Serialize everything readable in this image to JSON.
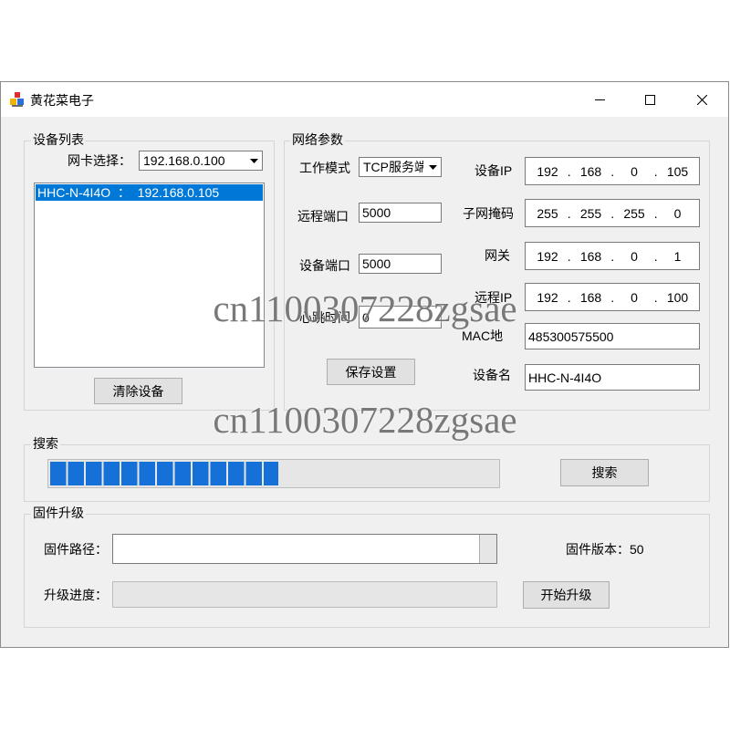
{
  "window": {
    "title": "黄花菜电子"
  },
  "icons": {
    "app": "app-icon",
    "minimize": "minimize-icon",
    "maximize": "maximize-icon",
    "close": "close-icon",
    "dropdown": "chevron-down-icon"
  },
  "theme": {
    "selection_color": "#0078d7",
    "progress_color": "#1570d8",
    "window_background": "#f0f0f0"
  },
  "device_list": {
    "group_label": "设备列表",
    "nic_label": "网卡选择：",
    "nic_selected": "192.168.0.100",
    "items": [
      {
        "text": "HHC-N-4I4O  ：  192.168.0.105",
        "selected": true
      }
    ],
    "clear_button": "清除设备"
  },
  "network_params": {
    "group_label": "网络参数",
    "ip_separator": ".",
    "work_mode": {
      "label": "工作模式",
      "value": "TCP服务端"
    },
    "remote_port": {
      "label": "远程端口",
      "value": "5000"
    },
    "device_port": {
      "label": "设备端口",
      "value": "5000"
    },
    "heartbeat": {
      "label": "心跳时间",
      "value": "0"
    },
    "save_button": "保存设置",
    "device_ip": {
      "label": "设备IP",
      "octets": [
        "192",
        "168",
        "0",
        "105"
      ]
    },
    "subnet_mask": {
      "label": "子网掩码",
      "octets": [
        "255",
        "255",
        "255",
        "0"
      ]
    },
    "gateway": {
      "label": "网关",
      "octets": [
        "192",
        "168",
        "0",
        "1"
      ]
    },
    "remote_ip": {
      "label": "远程IP",
      "octets": [
        "192",
        "168",
        "0",
        "100"
      ]
    },
    "mac": {
      "label": "MAC地",
      "value": "485300575500"
    },
    "device_name": {
      "label": "设备名",
      "value": "HHC-N-4I4O"
    }
  },
  "search": {
    "group_label": "搜索",
    "progress_percent": 51,
    "search_button": "搜索"
  },
  "firmware": {
    "group_label": "固件升级",
    "path_label": "固件路径：",
    "path_value": "",
    "version_label": "固件版本：",
    "version_value": "50",
    "progress_label": "升级进度：",
    "progress_percent": 0,
    "start_button": "开始升级"
  },
  "watermark": [
    "cn1100307228zgsae",
    "cn1100307228zgsae"
  ]
}
